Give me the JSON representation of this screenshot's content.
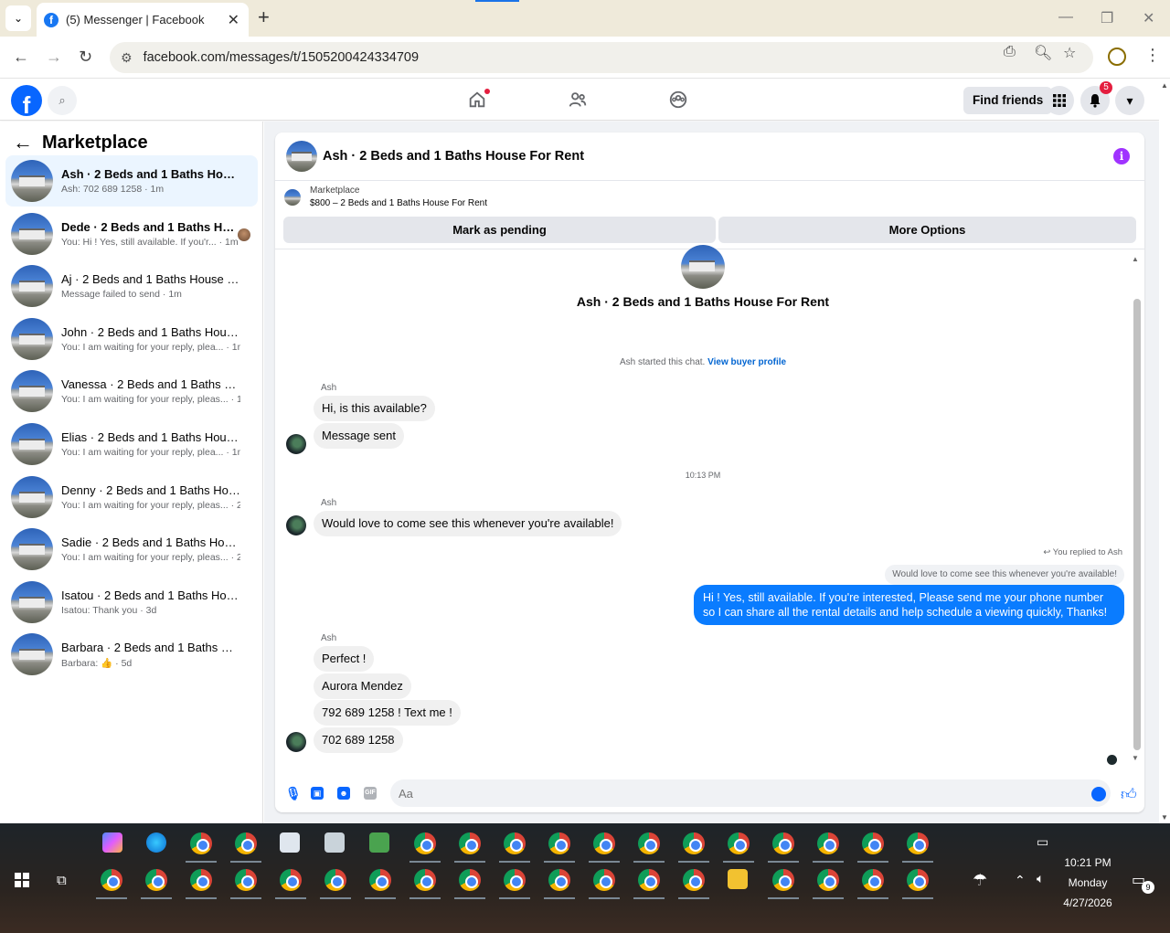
{
  "browser": {
    "tab_title": "(5) Messenger | Facebook",
    "url": "facebook.com/messages/t/1505200424334709"
  },
  "fb_header": {
    "find_friends": "Find friends",
    "notification_count": "5"
  },
  "sidebar": {
    "title": "Marketplace",
    "conversations": [
      {
        "name": "Ash · 2 Beds and 1 Baths House Fo...",
        "sub": "Ash: 702 689 1258 · 1m",
        "bold": true,
        "active": true
      },
      {
        "name": "Dede · 2 Beds and 1 Baths Hous...",
        "sub": "You: Hi ! Yes, still available. If you'r... · 1m",
        "bold": true
      },
      {
        "name": "Aj · 2 Beds and 1 Baths House For ...",
        "sub": "Message failed to send · 1m",
        "bold": false
      },
      {
        "name": "John · 2 Beds and 1 Baths House F...",
        "sub": "You: I am waiting for your reply, plea... · 1m",
        "bold": false
      },
      {
        "name": "Vanessa · 2 Beds and 1 Baths Hous...",
        "sub": "You: I am waiting for your reply, pleas... · 1m",
        "bold": false
      },
      {
        "name": "Elias · 2 Beds and 1 Baths House F...",
        "sub": "You: I am waiting for your reply, plea... · 1m",
        "bold": false
      },
      {
        "name": "Denny · 2 Beds and 1 Baths House ...",
        "sub": "You: I am waiting for your reply, pleas... · 2d",
        "bold": false
      },
      {
        "name": "Sadie · 2 Beds and 1 Baths House F...",
        "sub": "You: I am waiting for your reply, pleas... · 2d",
        "bold": false
      },
      {
        "name": "Isatou · 2 Beds and 1 Baths House ...",
        "sub": "Isatou: Thank you · 3d",
        "bold": false
      },
      {
        "name": "Barbara · 2 Beds and 1 Baths Hous...",
        "sub": "Barbara: 👍 · 5d",
        "bold": false
      }
    ]
  },
  "chat": {
    "title": "Ash · 2 Beds and 1 Baths House For Rent",
    "marketplace_label": "Marketplace",
    "listing": "$800 – 2 Beds and 1 Baths House For Rent",
    "mark_pending": "Mark as pending",
    "more_options": "More Options",
    "hero_title": "Ash · 2 Beds and 1 Baths House For Rent",
    "started_text": "Ash started this chat.",
    "view_profile": "View buyer profile",
    "sender_name": "Ash",
    "msg1": "Hi, is this available?",
    "msg2": "Message sent",
    "timestamp": "10:13 PM",
    "msg3": "Would love to come see this whenever you're available!",
    "replied_to": "You replied to Ash",
    "quoted": "Would love to come see this whenever you're available!",
    "outgoing": "Hi ! Yes, still available. If you're interested, Please send me your phone number so I can share all the rental details and help schedule a viewing quickly, Thanks!",
    "msg4": "Perfect !",
    "msg5": "Aurora Mendez",
    "msg6": "792 689 1258 ! Text me !",
    "msg7": "702 689 1258",
    "composer_placeholder": "Aa"
  },
  "taskbar": {
    "time": "10:21 PM",
    "day": "Monday",
    "date": "4/27/2026",
    "notif_count": "9"
  }
}
